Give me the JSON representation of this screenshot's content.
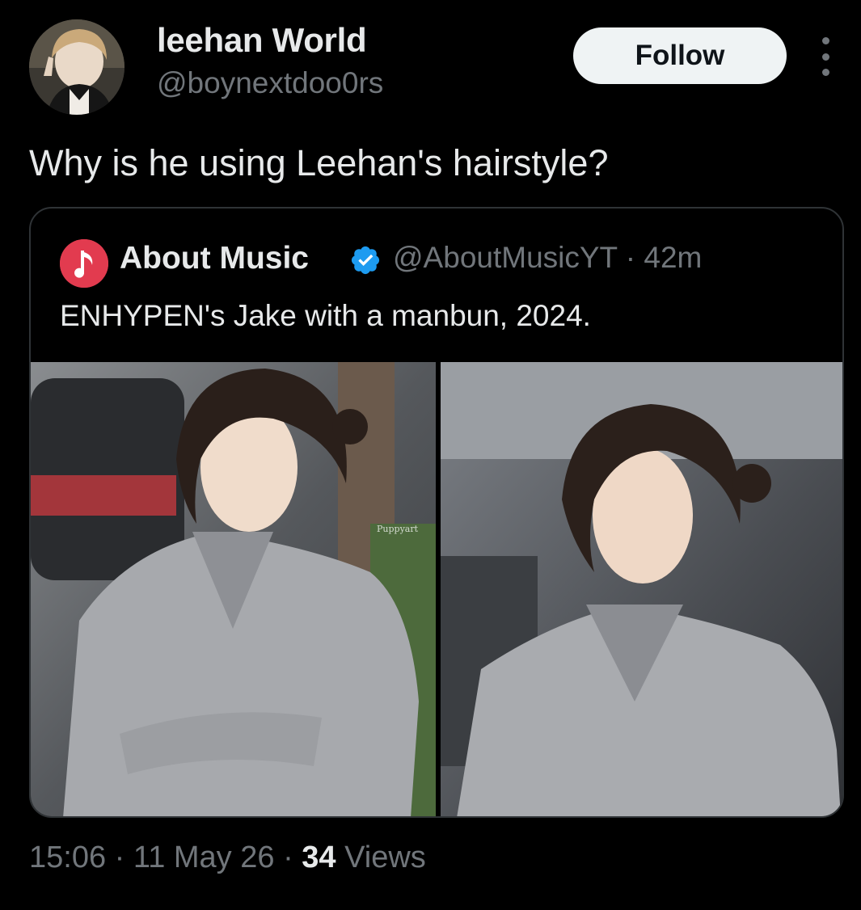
{
  "author": {
    "display_name": "leehan World",
    "handle": "@boynextdoo0rs"
  },
  "follow_label": "Follow",
  "tweet_text": "Why is he using Leehan's hairstyle?",
  "quoted": {
    "display_name": "About Music",
    "handle": "@AboutMusicYT",
    "separator": "·",
    "age": "42m",
    "text": "ENHYPEN's Jake with a manbun, 2024.",
    "photo_watermark": "Puppyart"
  },
  "footer": {
    "time": "15:06",
    "separator": "·",
    "date": "11 May 26",
    "views_count": "34",
    "views_label": "Views"
  },
  "colors": {
    "background": "#000000",
    "primary_text": "#e7e9ea",
    "secondary_text": "#71767b",
    "border": "#2f3336",
    "verified": "#1d9bf0",
    "follow_bg": "#eff3f4"
  },
  "icons": [
    "more-vertical-icon",
    "verified-badge-icon",
    "music-note-icon"
  ]
}
